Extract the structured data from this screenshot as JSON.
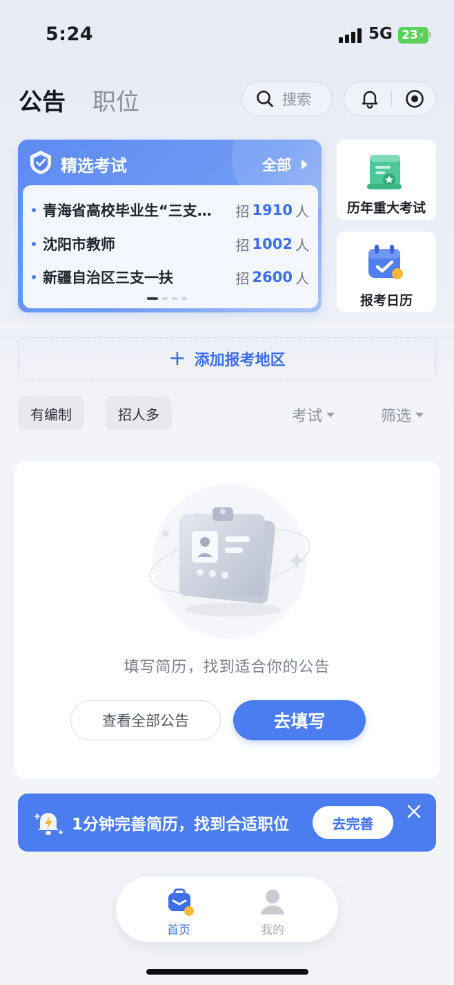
{
  "status_bar": {
    "time": "5:24",
    "network": "5G",
    "battery": "23"
  },
  "header": {
    "tab_active": "公告",
    "tab_inactive": "职位",
    "search_label": "搜索"
  },
  "featured_exams": {
    "title": "精选考试",
    "view_all": "全部",
    "items": [
      {
        "name": "青海省高校毕业生“三支…",
        "prefix": "招",
        "count": "1910",
        "suffix": "人"
      },
      {
        "name": "沈阳市教师",
        "prefix": "招",
        "count": "1002",
        "suffix": "人"
      },
      {
        "name": "新疆自治区三支一扶",
        "prefix": "招",
        "count": "2600",
        "suffix": "人"
      }
    ],
    "page_count": 4,
    "current_page": 1
  },
  "side_cards": {
    "history_label": "历年重大考试",
    "calendar_label": "报考日历"
  },
  "add_region": {
    "label": "添加报考地区"
  },
  "filters": {
    "chips": [
      "有编制",
      "招人多"
    ],
    "dropdowns": [
      "考试",
      "筛选"
    ]
  },
  "empty_state": {
    "message": "填写简历，找到适合你的公告",
    "secondary_button": "查看全部公告",
    "primary_button": "去填写"
  },
  "promo_banner": {
    "text": "1分钟完善简历，找到合适职位",
    "button": "去完善"
  },
  "bottom_nav": {
    "home": "首页",
    "mine": "我的"
  },
  "colors": {
    "accent": "#4b7cf0",
    "accent_text": "#3e6ee8",
    "battery": "#5bd05a"
  }
}
